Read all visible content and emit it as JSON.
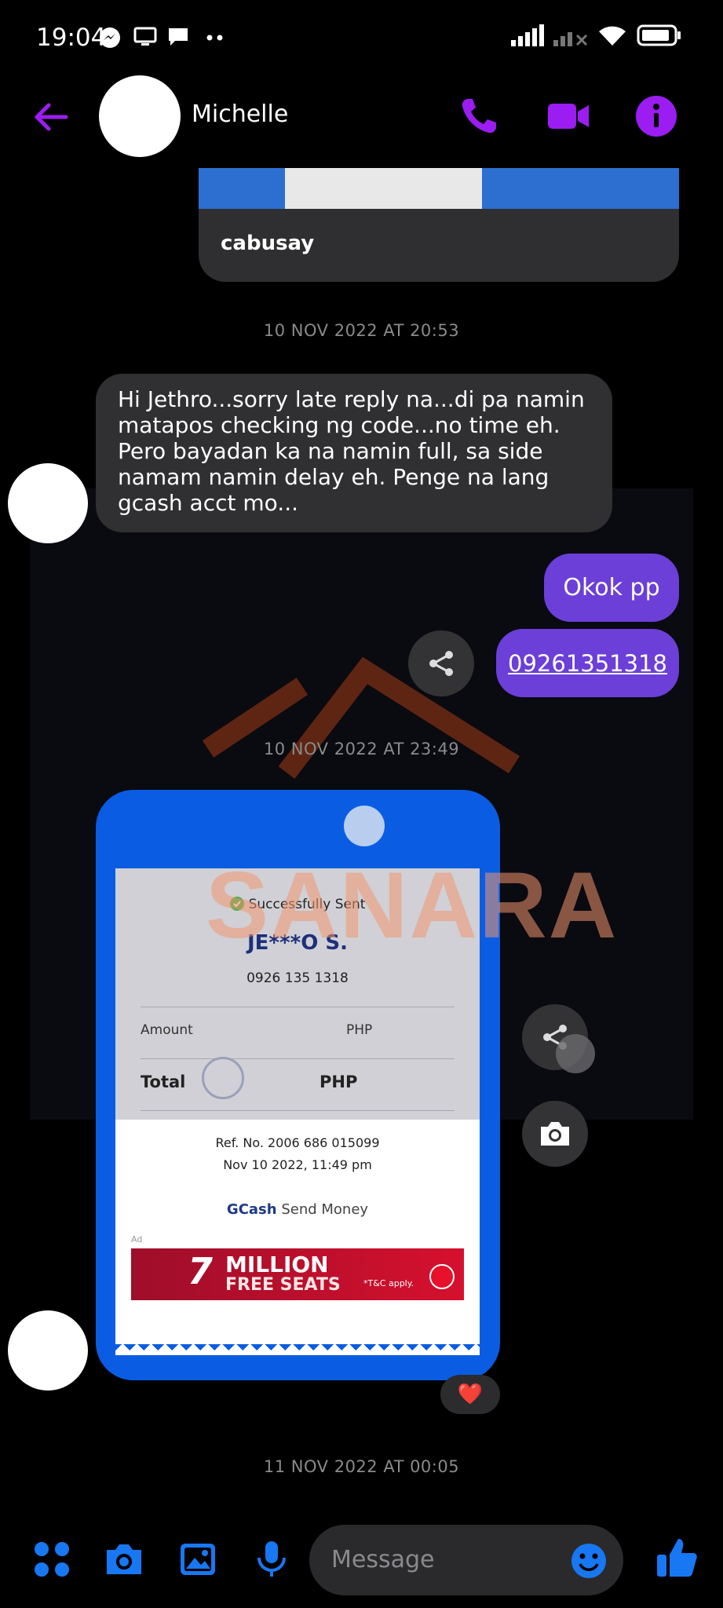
{
  "status_bar": {
    "time": "19:04"
  },
  "header": {
    "contact_name": "Michelle"
  },
  "colors": {
    "accent": "#9b1df2",
    "outgoing_bubble": "#6b3fd8",
    "incoming_bubble": "#303033",
    "bottom_icons": "#1877f2"
  },
  "messages": {
    "link_card_text": "cabusay",
    "timestamp_1": "10 NOV 2022 AT 20:53",
    "incoming_1": "Hi Jethro...sorry late reply na...di pa namin matapos checking ng code...no time eh. Pero bayadan ka na namin full, sa side namam namin delay eh. Penge na lang gcash acct mo...",
    "outgoing_1": "Okok pp",
    "outgoing_2": "09261351318",
    "timestamp_2": "10 NOV 2022 AT 23:49",
    "reaction": "❤️",
    "timestamp_3": "11 NOV 2022 AT 00:05"
  },
  "watermark": {
    "text": "SANARA"
  },
  "receipt": {
    "status": "Successfully Sent",
    "recipient": "JE***O S.",
    "number": "0926 135 1318",
    "amount_label": "Amount",
    "amount_currency": "PHP",
    "total_label": "Total",
    "total_currency": "PHP",
    "ref_no": "Ref. No. 2006 686 015099",
    "datetime": "Nov 10 2022, 11:49 pm",
    "brand": "GCash",
    "service": "Send Money",
    "ad_label": "Ad",
    "ad_headline_1": "MILLION",
    "ad_headline_2": "FREE SEATS",
    "ad_note": "*T&C apply.",
    "ad_number": "7"
  },
  "composer": {
    "placeholder": "Message"
  }
}
